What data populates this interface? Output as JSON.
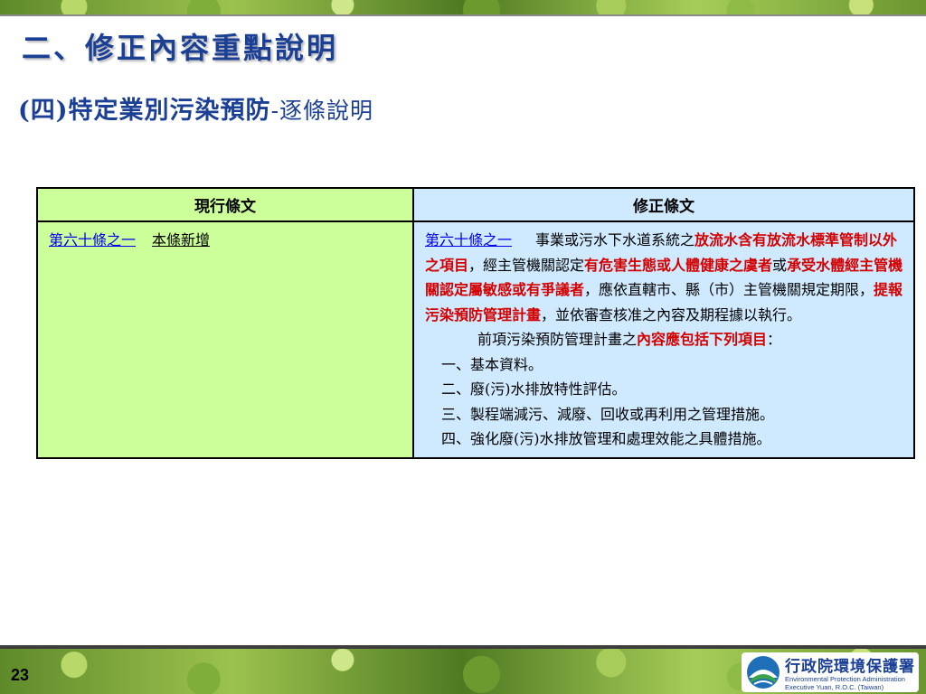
{
  "slide": {
    "title": "二、修正內容重點說明",
    "subtitle_main": "(四)特定業別污染預防",
    "subtitle_suffix": "-逐條說明",
    "page_number": "23"
  },
  "table": {
    "headers": [
      "現行條文",
      "修正條文"
    ],
    "current": {
      "article_link": "第六十條之一",
      "note": "本條新增"
    },
    "revised": {
      "article_link": "第六十條之一",
      "p1": [
        {
          "t": "事業或污水下水道系統之",
          "red": false
        },
        {
          "t": "放流水含有放流水標準管制以外之項目",
          "red": true
        },
        {
          "t": "，經主管機關認定",
          "red": false
        },
        {
          "t": "有危害生態或人體健康之虞者",
          "red": true
        },
        {
          "t": "或",
          "red": false
        },
        {
          "t": "承受水體經主管機關認定屬敏感或有爭議者",
          "red": true
        },
        {
          "t": "，應依直轄市、縣（市）主管機關規定期限，",
          "red": false
        },
        {
          "t": "提報污染預防管理計畫",
          "red": true
        },
        {
          "t": "，並依審查核准之內容及期程據以執行。",
          "red": false
        }
      ],
      "p2_lead": "前項污染預防管理計畫之",
      "p2_red": "內容應包括下列項目",
      "p2_tail": "：",
      "items": [
        "一、基本資料。",
        "二、廢(污)水排放特性評估。",
        "三、製程端減污、減廢、回收或再利用之管理措施。",
        "四、強化廢(污)水排放管理和處理效能之具體措施。"
      ]
    }
  },
  "footer": {
    "org_zh": "行政院環境保護署",
    "org_en_line1": "Environmental Protection Administration",
    "org_en_line2": "Executive Yuan, R.O.C. (Taiwan)"
  },
  "colors": {
    "title_blue": "#1a3f95",
    "current_bg": "#ccff99",
    "revised_bg": "#cfe9ff",
    "emphasis_red": "#d40000"
  }
}
